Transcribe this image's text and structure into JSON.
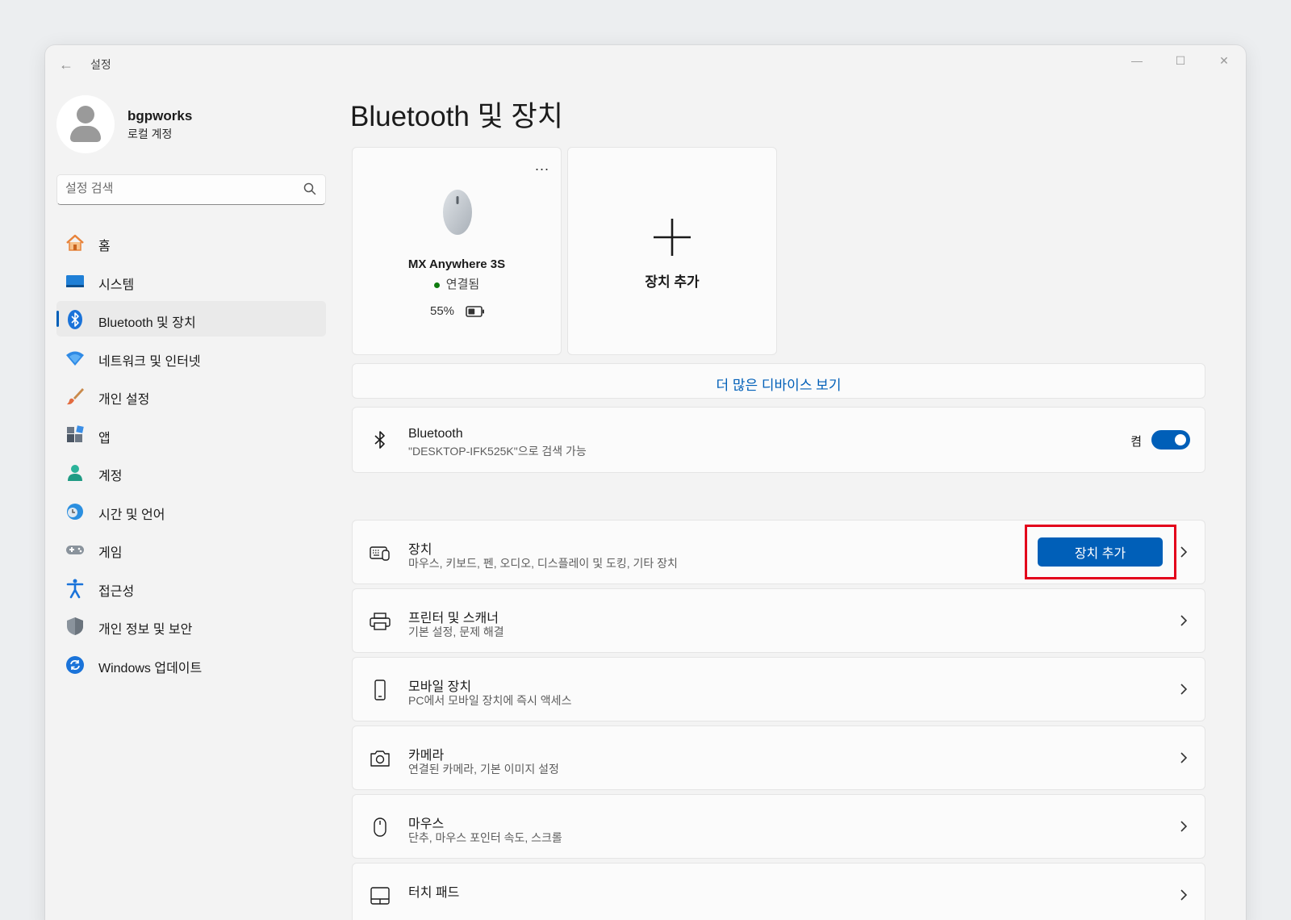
{
  "window": {
    "title": "설정"
  },
  "profile": {
    "name": "bgpworks",
    "account_type": "로컬 계정"
  },
  "search": {
    "placeholder": "설정 검색"
  },
  "sidebar": {
    "items": [
      {
        "label": "홈",
        "icon": "home-icon"
      },
      {
        "label": "시스템",
        "icon": "system-icon"
      },
      {
        "label": "Bluetooth 및 장치",
        "icon": "bluetooth-icon",
        "active": true
      },
      {
        "label": "네트워크 및 인터넷",
        "icon": "wifi-icon"
      },
      {
        "label": "개인 설정",
        "icon": "brush-icon"
      },
      {
        "label": "앱",
        "icon": "apps-icon"
      },
      {
        "label": "계정",
        "icon": "account-icon"
      },
      {
        "label": "시간 및 언어",
        "icon": "time-language-icon"
      },
      {
        "label": "게임",
        "icon": "gamepad-icon"
      },
      {
        "label": "접근성",
        "icon": "accessibility-icon"
      },
      {
        "label": "개인 정보 및 보안",
        "icon": "shield-icon"
      },
      {
        "label": "Windows 업데이트",
        "icon": "update-icon"
      }
    ]
  },
  "main": {
    "title": "Bluetooth 및 장치",
    "device_card": {
      "more": "...",
      "name": "MX Anywhere 3S",
      "status": "연결됨",
      "battery": "55%",
      "battery_level": 0.55
    },
    "add_card": {
      "label": "장치 추가"
    },
    "more_devices": "더 많은 디바이스 보기",
    "bluetooth": {
      "title": "Bluetooth",
      "subtitle": "\"DESKTOP-IFK525K\"으로 검색 가능",
      "state": "켬",
      "enabled": true
    },
    "rows": [
      {
        "title": "장치",
        "subtitle": "마우스, 키보드, 펜, 오디오, 디스플레이 및 도킹, 기타 장치",
        "icon": "devices-icon",
        "button": "장치 추가"
      },
      {
        "title": "프린터 및 스캐너",
        "subtitle": "기본 설정, 문제 해결",
        "icon": "printer-icon"
      },
      {
        "title": "모바일 장치",
        "subtitle": "PC에서 모바일 장치에 즉시 액세스",
        "icon": "phone-icon"
      },
      {
        "title": "카메라",
        "subtitle": "연결된 카메라, 기본 이미지 설정",
        "icon": "camera-icon"
      },
      {
        "title": "마우스",
        "subtitle": "단추, 마우스 포인터 속도, 스크롤",
        "icon": "mouse-icon"
      },
      {
        "title": "터치 패드",
        "subtitle": "",
        "icon": "touchpad-icon"
      }
    ]
  },
  "colors": {
    "accent": "#005fb8",
    "highlight": "#e3001b"
  }
}
